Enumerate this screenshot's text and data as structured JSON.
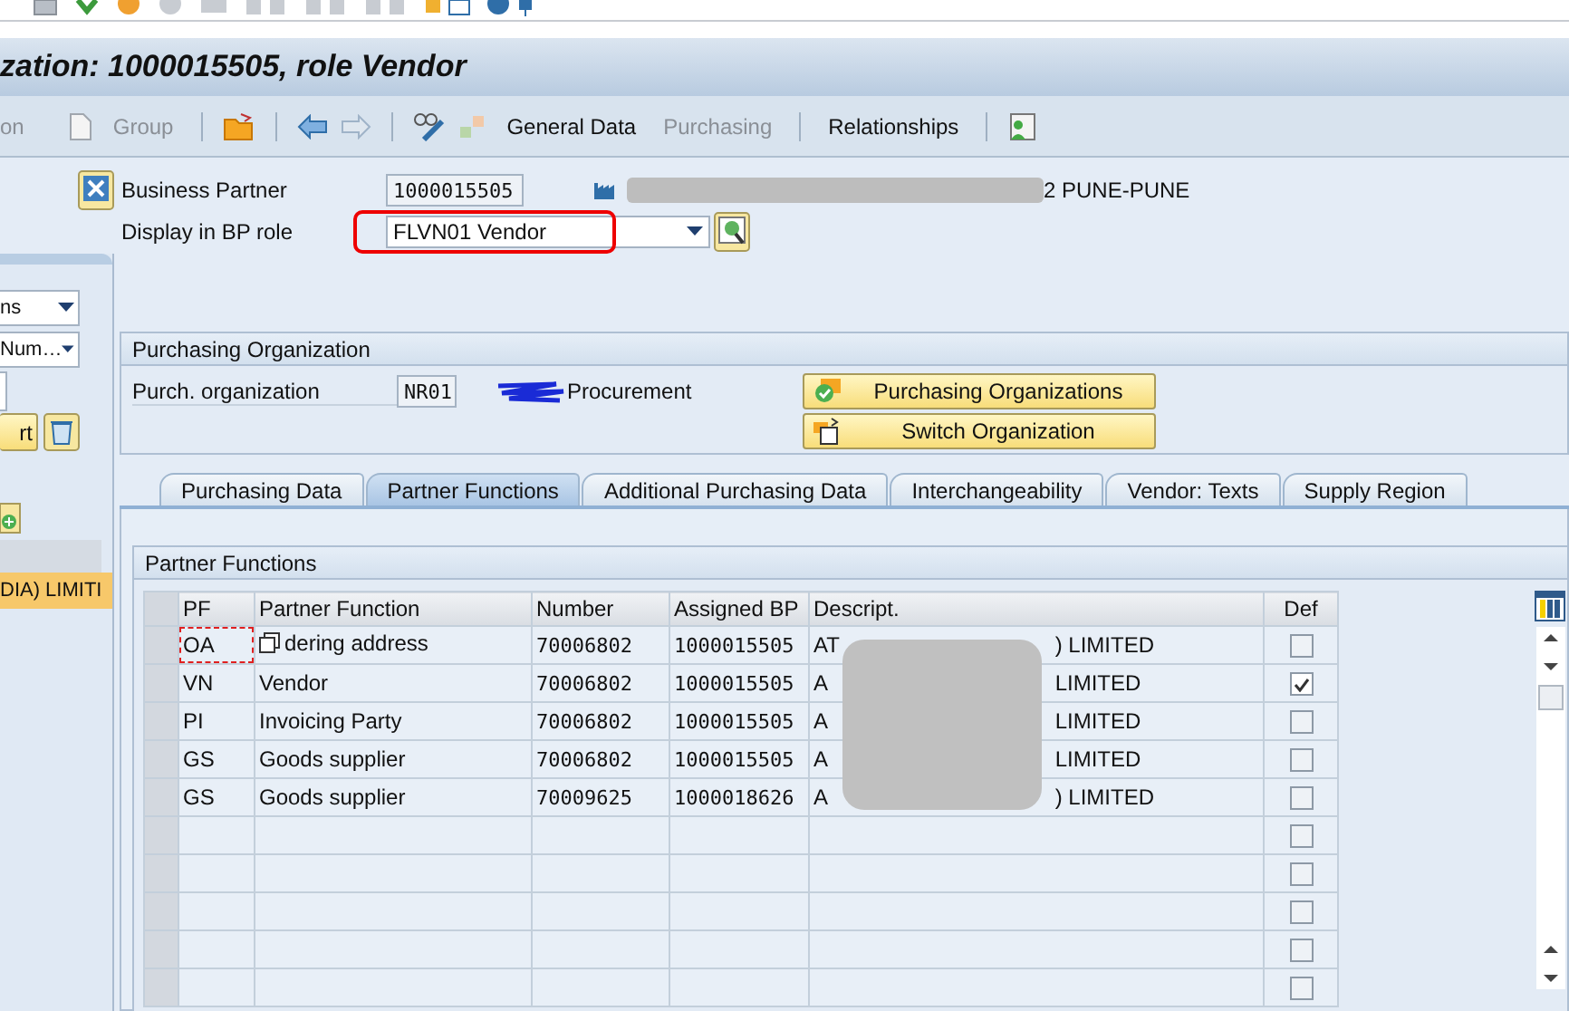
{
  "title": "zation: 1000015505, role Vendor",
  "toolbar": {
    "cut_button": {
      "label": "on",
      "disabled": true
    },
    "group_button": {
      "label": "Group",
      "disabled": true
    },
    "general_data_button": {
      "label": "General Data",
      "disabled": false
    },
    "purchasing_button": {
      "label": "Purchasing",
      "disabled": true
    },
    "relationships_button": {
      "label": "Relationships",
      "disabled": false
    }
  },
  "header": {
    "business_partner": {
      "label": "Business Partner",
      "value": "1000015505",
      "name_tail": "2 PUNE-PUNE"
    },
    "role": {
      "label": "Display in BP role",
      "value": "FLVN01 Vendor"
    }
  },
  "side_panel": {
    "dropdown_1": "ns",
    "dropdown_2": "Num…",
    "button": "rt",
    "result_row": "DIA) LIMITI"
  },
  "purchasing_org": {
    "title": "Purchasing Organization",
    "label": "Purch. organization",
    "value": "NR01",
    "description": "Procurement",
    "buttons": [
      "Purchasing Organizations",
      "Switch Organization"
    ]
  },
  "tabs": [
    {
      "label": "Purchasing Data",
      "selected": false
    },
    {
      "label": "Partner Functions",
      "selected": true
    },
    {
      "label": "Additional Purchasing Data",
      "selected": false
    },
    {
      "label": "Interchangeability",
      "selected": false
    },
    {
      "label": "Vendor: Texts",
      "selected": false
    },
    {
      "label": "Supply Region",
      "selected": false
    }
  ],
  "partner_functions": {
    "title": "Partner Functions",
    "columns": [
      "PF",
      "Partner Function",
      "Number",
      "Assigned BP",
      "Descript.",
      "Def"
    ],
    "rows": [
      {
        "pf": "OA",
        "function": "dering address",
        "number": "70006802",
        "assigned_bp": "1000015505",
        "descript_start": "AT",
        "descript_end": ") LIMITED",
        "def": false,
        "focused": true
      },
      {
        "pf": "VN",
        "function": "Vendor",
        "number": "70006802",
        "assigned_bp": "1000015505",
        "descript_start": "A",
        "descript_end": "LIMITED",
        "def": true,
        "focused": false
      },
      {
        "pf": "PI",
        "function": "Invoicing Party",
        "number": "70006802",
        "assigned_bp": "1000015505",
        "descript_start": "A",
        "descript_end": "LIMITED",
        "def": false,
        "focused": false
      },
      {
        "pf": "GS",
        "function": "Goods supplier",
        "number": "70006802",
        "assigned_bp": "1000015505",
        "descript_start": "A",
        "descript_end": "LIMITED",
        "def": false,
        "focused": false
      },
      {
        "pf": "GS",
        "function": "Goods supplier",
        "number": "70009625",
        "assigned_bp": "1000018626",
        "descript_start": "A",
        "descript_end": ") LIMITED",
        "def": false,
        "focused": false
      },
      {
        "def": false,
        "focused": false
      },
      {
        "def": false,
        "focused": false
      },
      {
        "def": false,
        "focused": false
      },
      {
        "def": false,
        "focused": false
      },
      {
        "def": false,
        "focused": false
      }
    ]
  }
}
